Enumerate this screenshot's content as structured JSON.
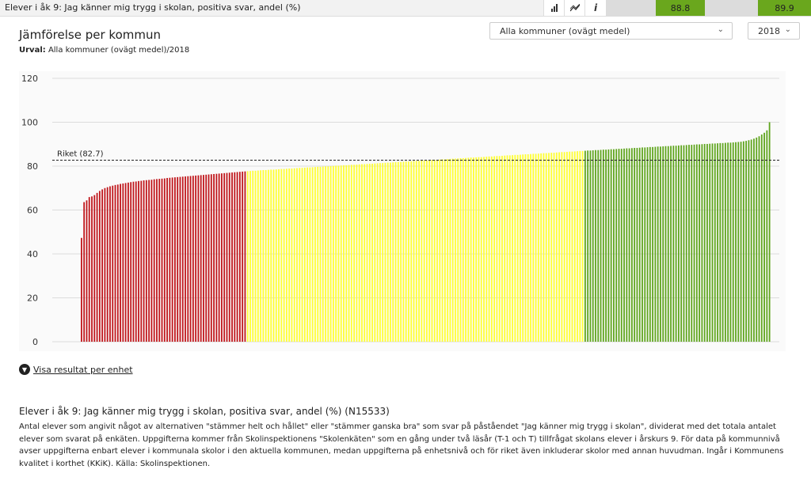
{
  "topbar": {
    "title": "Elever i åk 9: Jag känner mig trygg i skolan, positiva svar, andel (%)",
    "icons": [
      "bar-chart-icon",
      "trend-icon",
      "info-icon"
    ],
    "value_1": "88.8",
    "value_2": "89.9",
    "value_color": "#6aa71d"
  },
  "header": {
    "title": "Jämförelse per kommun",
    "urval_label": "Urval:",
    "urval_value": "Alla kommuner (ovägt medel)/2018"
  },
  "controls": {
    "municipality_select": "Alla kommuner (ovägt medel)",
    "year_select": "2018"
  },
  "chart_data": {
    "type": "bar",
    "ylim": [
      0,
      120
    ],
    "yticks": [
      "0",
      "20",
      "40",
      "60",
      "80",
      "100",
      "120"
    ],
    "reference_label": "Riket (82.7)",
    "reference_value": 82.7,
    "marker_index": 270,
    "colors": {
      "low": "#c0161b",
      "mid": "#ffff33",
      "high": "#5fa51d"
    },
    "groups": [
      {
        "color": "low",
        "values": [
          47.3,
          63.6,
          64.4,
          65.9,
          66.2,
          66.8,
          67.8,
          68.7,
          69.4,
          70.0,
          70.4,
          70.8,
          71.1,
          71.4,
          71.6,
          71.9,
          72.1,
          72.3,
          72.5,
          72.7,
          72.9,
          73.0,
          73.2,
          73.3,
          73.5,
          73.6,
          73.7,
          73.8,
          74.0,
          74.1,
          74.2,
          74.3,
          74.4,
          74.6,
          74.7,
          74.8,
          74.9,
          75.0,
          75.1,
          75.2,
          75.3,
          75.4,
          75.5,
          75.6,
          75.7,
          75.8,
          75.9,
          76.0,
          76.1,
          76.2,
          76.3,
          76.4,
          76.5,
          76.6,
          76.7,
          76.8,
          76.9,
          77.0,
          77.1,
          77.2,
          77.3,
          77.4,
          77.5,
          77.6
        ]
      },
      {
        "color": "mid",
        "values": [
          77.7,
          77.8,
          77.9,
          77.9,
          78.0,
          78.1,
          78.2,
          78.2,
          78.3,
          78.4,
          78.4,
          78.5,
          78.6,
          78.7,
          78.7,
          78.8,
          78.9,
          78.9,
          79.0,
          79.1,
          79.2,
          79.2,
          79.3,
          79.4,
          79.4,
          79.5,
          79.6,
          79.7,
          79.7,
          79.8,
          79.9,
          79.9,
          80.0,
          80.1,
          80.2,
          80.2,
          80.3,
          80.4,
          80.4,
          80.5,
          80.6,
          80.6,
          80.7,
          80.8,
          80.9,
          80.9,
          81.0,
          81.1,
          81.1,
          81.2,
          81.3,
          81.4,
          81.4,
          81.5,
          81.6,
          81.6,
          81.7,
          81.8,
          81.9,
          81.9,
          82.0,
          82.1,
          82.1,
          82.2,
          82.3,
          82.4,
          82.4,
          82.5,
          82.6,
          82.6,
          82.7,
          82.8,
          82.9,
          82.9,
          83.0,
          83.1,
          83.1,
          83.2,
          83.3,
          83.4,
          83.4,
          83.5,
          83.6,
          83.6,
          83.7,
          83.8,
          83.9,
          83.9,
          84.0,
          84.1,
          84.1,
          84.2,
          84.3,
          84.4,
          84.4,
          84.5,
          84.6,
          84.6,
          84.7,
          84.8,
          84.9,
          84.9,
          85.0,
          85.1,
          85.1,
          85.2,
          85.3,
          85.4,
          85.4,
          85.5,
          85.6,
          85.6,
          85.7,
          85.8,
          85.9,
          85.9,
          86.0,
          86.1,
          86.1,
          86.2,
          86.3,
          86.4,
          86.4,
          86.5,
          86.6,
          86.6,
          86.7,
          86.8,
          86.9,
          86.9
        ]
      },
      {
        "color": "high",
        "values": [
          87.0,
          87.1,
          87.1,
          87.2,
          87.3,
          87.3,
          87.4,
          87.5,
          87.5,
          87.6,
          87.7,
          87.7,
          87.8,
          87.9,
          87.9,
          88.0,
          88.1,
          88.1,
          88.2,
          88.3,
          88.3,
          88.4,
          88.5,
          88.5,
          88.6,
          88.7,
          88.7,
          88.8,
          88.9,
          88.9,
          89.0,
          89.1,
          89.1,
          89.2,
          89.3,
          89.3,
          89.4,
          89.5,
          89.5,
          89.6,
          89.7,
          89.7,
          89.8,
          89.9,
          89.9,
          90.0,
          90.1,
          90.1,
          90.2,
          90.3,
          90.3,
          90.4,
          90.5,
          90.5,
          90.6,
          90.7,
          90.7,
          90.8,
          90.9,
          91.0,
          91.1,
          91.3,
          91.5,
          91.8,
          92.1,
          92.5,
          93.0,
          93.6,
          94.4,
          95.2,
          96.3,
          100.0
        ]
      }
    ]
  },
  "toggle": {
    "label": "Visa resultat per enhet"
  },
  "description": {
    "title": "Elever i åk 9: Jag känner mig trygg i skolan, positiva svar, andel (%) (N15533)",
    "text": "Antal elever som angivit något av alternativen \"stämmer helt och hållet\" eller \"stämmer ganska bra\" som svar på påståendet \"Jag känner mig trygg i skolan\", dividerat med det totala antalet elever som svarat på enkäten. Uppgifterna kommer från Skolinspektionens \"Skolenkäten\" som en gång under två läsår (T-1 och T) tillfrågat skolans elever i årskurs 9. För data på kommunnivå avser uppgifterna enbart elever i kommunala skolor i den aktuella kommunen, medan uppgifterna på enhetsnivå och för riket även inkluderar skolor med annan huvudman. Ingår i Kommunens kvalitet i korthet (KKiK). Källa: Skolinspektionen."
  }
}
